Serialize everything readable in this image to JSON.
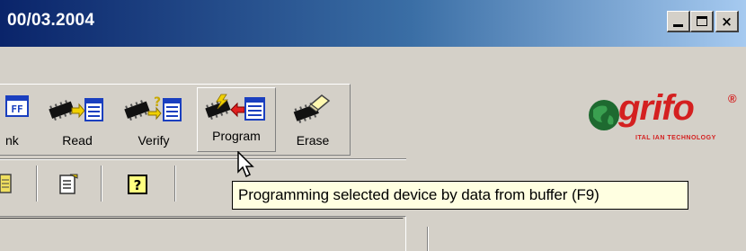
{
  "window": {
    "title": "00/03.2004",
    "minimize_label": "_",
    "close_label": "×"
  },
  "toolbar": {
    "buttons": [
      {
        "label": "nk",
        "icon": "blank-buffer-icon"
      },
      {
        "label": "Read",
        "icon": "read-chip-icon"
      },
      {
        "label": "Verify",
        "icon": "verify-chip-icon"
      },
      {
        "label": "Program",
        "icon": "program-chip-icon",
        "state": "hovered"
      },
      {
        "label": "Erase",
        "icon": "erase-chip-icon"
      }
    ],
    "blank_icon_text": "FF"
  },
  "toolbar2": {
    "icons": [
      "buffer-icon",
      "edit-icon",
      "help-icon"
    ],
    "help_glyph": "?"
  },
  "tooltip": {
    "text": "Programming selected device by data from buffer (F9)"
  },
  "logo": {
    "name": "grifo",
    "registered": "®",
    "tagline": "ITAL IAN TECHNOLOGY"
  },
  "colors": {
    "title_start": "#0a246a",
    "title_end": "#a6caf0",
    "tooltip_bg": "#ffffe1",
    "logo_red": "#d42020",
    "logo_green": "#1e6a30"
  }
}
